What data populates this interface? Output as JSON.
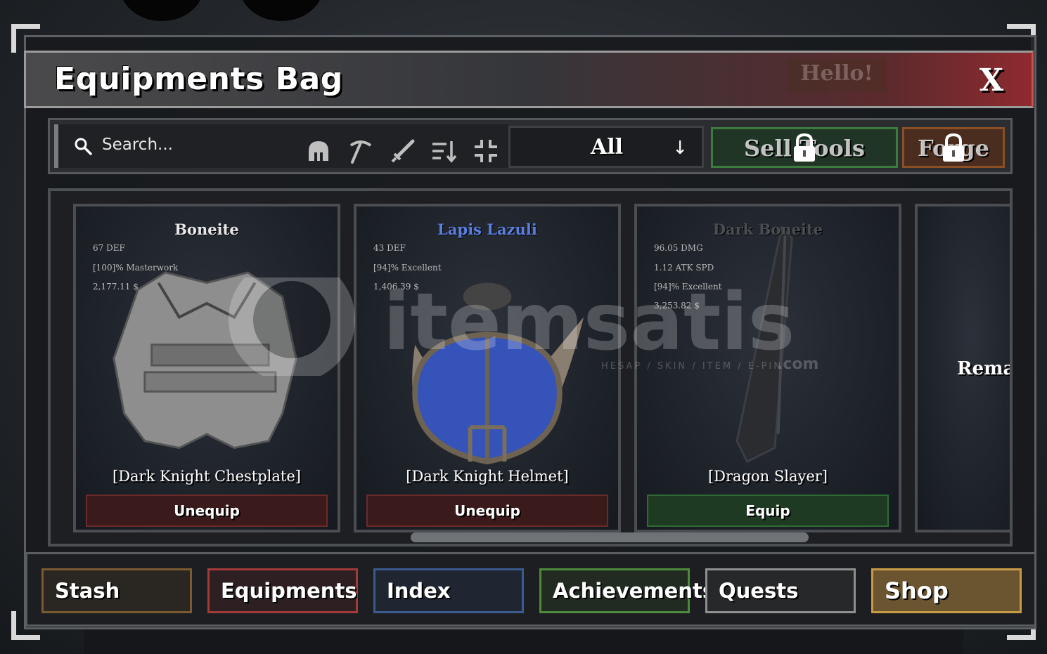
{
  "window": {
    "title": "Equipments Bag",
    "close_label": "X",
    "background_bubble": "Hello!"
  },
  "toolbar": {
    "search_placeholder": "Search...",
    "icons": [
      "helmet-icon",
      "pickaxe-icon",
      "sword-icon",
      "sort-icon",
      "collapse-icon"
    ],
    "filter_value": "All",
    "sell_tools_label": "Sell Tools",
    "forge_label": "Forge"
  },
  "cards": [
    {
      "name": "Boneite",
      "name_color": "#e8e8e8",
      "stats": [
        "67 DEF",
        "[100]% Masterwork",
        "2,177.11 $"
      ],
      "item": "[Dark Knight Chestplate]",
      "button": "Unequip",
      "button_state": "equipped"
    },
    {
      "name": "Lapis Lazuli",
      "name_color": "#5b7fe0",
      "stats": [
        "43 DEF",
        "[94]% Excellent",
        "1,406.39 $"
      ],
      "item": "[Dark Knight Helmet]",
      "button": "Unequip",
      "button_state": "equipped"
    },
    {
      "name": "Dark Boneite",
      "name_color": "#4a4d52",
      "stats": [
        "96.05 DMG",
        "1.12 ATK SPD",
        "[94]% Excellent",
        "3,253.82 $"
      ],
      "item": "[Dragon Slayer]",
      "button": "Equip",
      "button_state": "unequipped"
    }
  ],
  "partial_card_text": "Rema",
  "watermark": {
    "brand": "itemsatis",
    "tagline": "HESAP / SKIN / ITEM / E-PIN",
    "suffix": ".com"
  },
  "tabs": [
    {
      "label": "Stash",
      "color": "#7a5a30"
    },
    {
      "label": "Equipments",
      "color": "#a33a3a"
    },
    {
      "label": "Index",
      "color": "#3a5a90"
    },
    {
      "label": "Achievements",
      "color": "#4e8a3c"
    },
    {
      "label": "Quests",
      "color": "#8f8f8f"
    },
    {
      "label": "Shop",
      "color": "#c79a45"
    }
  ]
}
